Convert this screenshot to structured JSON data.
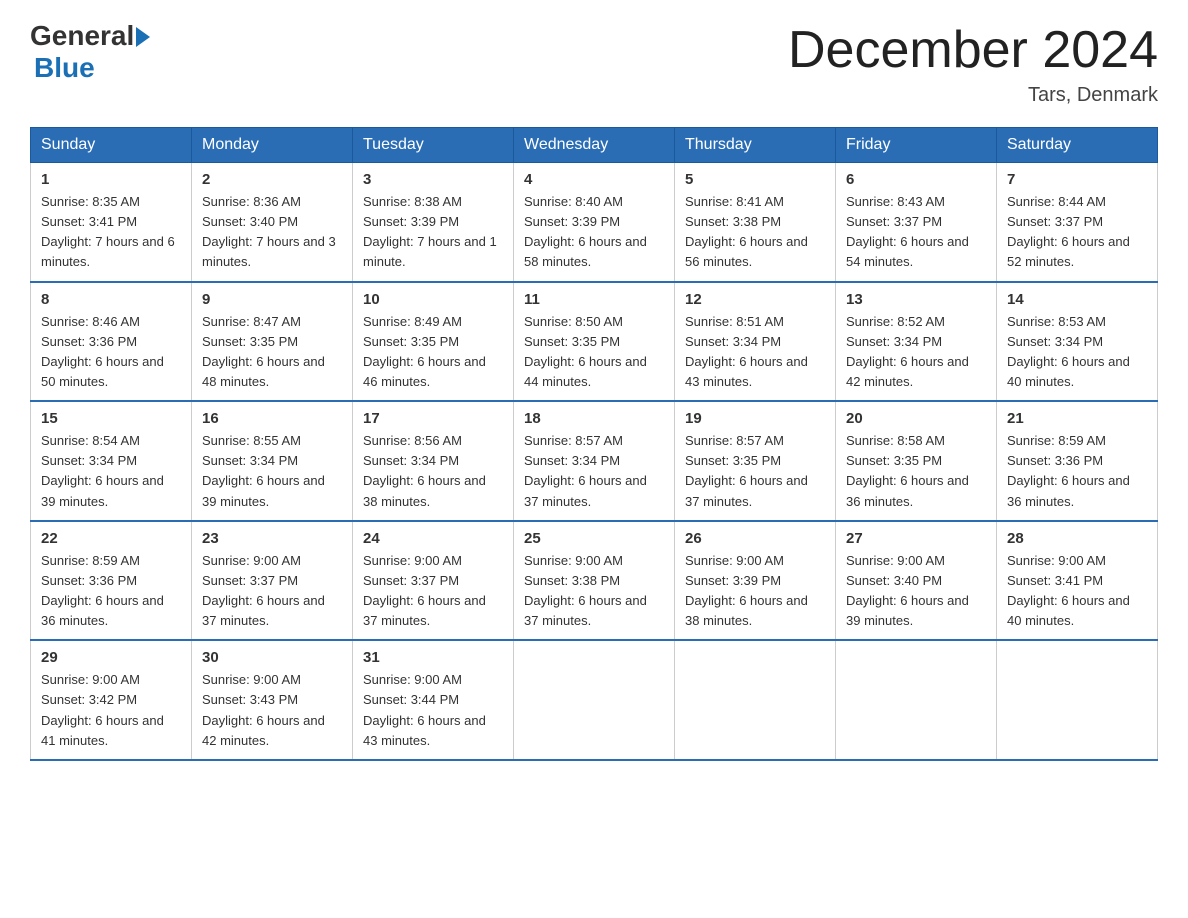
{
  "header": {
    "logo_general": "General",
    "logo_blue": "Blue",
    "month_title": "December 2024",
    "location": "Tars, Denmark"
  },
  "days_of_week": [
    "Sunday",
    "Monday",
    "Tuesday",
    "Wednesday",
    "Thursday",
    "Friday",
    "Saturday"
  ],
  "weeks": [
    [
      {
        "day": "1",
        "sunrise": "8:35 AM",
        "sunset": "3:41 PM",
        "daylight": "7 hours and 6 minutes."
      },
      {
        "day": "2",
        "sunrise": "8:36 AM",
        "sunset": "3:40 PM",
        "daylight": "7 hours and 3 minutes."
      },
      {
        "day": "3",
        "sunrise": "8:38 AM",
        "sunset": "3:39 PM",
        "daylight": "7 hours and 1 minute."
      },
      {
        "day": "4",
        "sunrise": "8:40 AM",
        "sunset": "3:39 PM",
        "daylight": "6 hours and 58 minutes."
      },
      {
        "day": "5",
        "sunrise": "8:41 AM",
        "sunset": "3:38 PM",
        "daylight": "6 hours and 56 minutes."
      },
      {
        "day": "6",
        "sunrise": "8:43 AM",
        "sunset": "3:37 PM",
        "daylight": "6 hours and 54 minutes."
      },
      {
        "day": "7",
        "sunrise": "8:44 AM",
        "sunset": "3:37 PM",
        "daylight": "6 hours and 52 minutes."
      }
    ],
    [
      {
        "day": "8",
        "sunrise": "8:46 AM",
        "sunset": "3:36 PM",
        "daylight": "6 hours and 50 minutes."
      },
      {
        "day": "9",
        "sunrise": "8:47 AM",
        "sunset": "3:35 PM",
        "daylight": "6 hours and 48 minutes."
      },
      {
        "day": "10",
        "sunrise": "8:49 AM",
        "sunset": "3:35 PM",
        "daylight": "6 hours and 46 minutes."
      },
      {
        "day": "11",
        "sunrise": "8:50 AM",
        "sunset": "3:35 PM",
        "daylight": "6 hours and 44 minutes."
      },
      {
        "day": "12",
        "sunrise": "8:51 AM",
        "sunset": "3:34 PM",
        "daylight": "6 hours and 43 minutes."
      },
      {
        "day": "13",
        "sunrise": "8:52 AM",
        "sunset": "3:34 PM",
        "daylight": "6 hours and 42 minutes."
      },
      {
        "day": "14",
        "sunrise": "8:53 AM",
        "sunset": "3:34 PM",
        "daylight": "6 hours and 40 minutes."
      }
    ],
    [
      {
        "day": "15",
        "sunrise": "8:54 AM",
        "sunset": "3:34 PM",
        "daylight": "6 hours and 39 minutes."
      },
      {
        "day": "16",
        "sunrise": "8:55 AM",
        "sunset": "3:34 PM",
        "daylight": "6 hours and 39 minutes."
      },
      {
        "day": "17",
        "sunrise": "8:56 AM",
        "sunset": "3:34 PM",
        "daylight": "6 hours and 38 minutes."
      },
      {
        "day": "18",
        "sunrise": "8:57 AM",
        "sunset": "3:34 PM",
        "daylight": "6 hours and 37 minutes."
      },
      {
        "day": "19",
        "sunrise": "8:57 AM",
        "sunset": "3:35 PM",
        "daylight": "6 hours and 37 minutes."
      },
      {
        "day": "20",
        "sunrise": "8:58 AM",
        "sunset": "3:35 PM",
        "daylight": "6 hours and 36 minutes."
      },
      {
        "day": "21",
        "sunrise": "8:59 AM",
        "sunset": "3:36 PM",
        "daylight": "6 hours and 36 minutes."
      }
    ],
    [
      {
        "day": "22",
        "sunrise": "8:59 AM",
        "sunset": "3:36 PM",
        "daylight": "6 hours and 36 minutes."
      },
      {
        "day": "23",
        "sunrise": "9:00 AM",
        "sunset": "3:37 PM",
        "daylight": "6 hours and 37 minutes."
      },
      {
        "day": "24",
        "sunrise": "9:00 AM",
        "sunset": "3:37 PM",
        "daylight": "6 hours and 37 minutes."
      },
      {
        "day": "25",
        "sunrise": "9:00 AM",
        "sunset": "3:38 PM",
        "daylight": "6 hours and 37 minutes."
      },
      {
        "day": "26",
        "sunrise": "9:00 AM",
        "sunset": "3:39 PM",
        "daylight": "6 hours and 38 minutes."
      },
      {
        "day": "27",
        "sunrise": "9:00 AM",
        "sunset": "3:40 PM",
        "daylight": "6 hours and 39 minutes."
      },
      {
        "day": "28",
        "sunrise": "9:00 AM",
        "sunset": "3:41 PM",
        "daylight": "6 hours and 40 minutes."
      }
    ],
    [
      {
        "day": "29",
        "sunrise": "9:00 AM",
        "sunset": "3:42 PM",
        "daylight": "6 hours and 41 minutes."
      },
      {
        "day": "30",
        "sunrise": "9:00 AM",
        "sunset": "3:43 PM",
        "daylight": "6 hours and 42 minutes."
      },
      {
        "day": "31",
        "sunrise": "9:00 AM",
        "sunset": "3:44 PM",
        "daylight": "6 hours and 43 minutes."
      },
      null,
      null,
      null,
      null
    ]
  ],
  "labels": {
    "sunrise_prefix": "Sunrise: ",
    "sunset_prefix": "Sunset: ",
    "daylight_prefix": "Daylight: "
  }
}
